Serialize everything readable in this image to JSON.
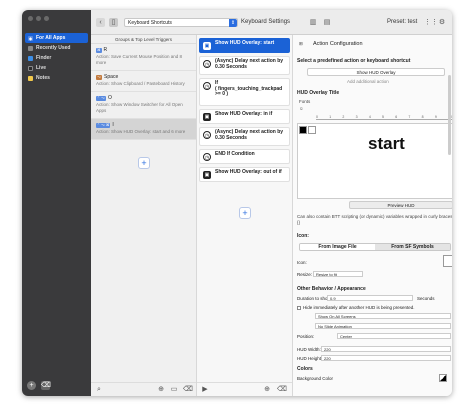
{
  "sidebar": {
    "apps": [
      {
        "label": "For All Apps",
        "selected": true
      },
      {
        "label": "Recently Used"
      },
      {
        "label": "Finder"
      },
      {
        "label": "Live"
      },
      {
        "label": "Notes"
      }
    ]
  },
  "toolbar": {
    "combo": "Keyboard Shortcuts",
    "settings": "Keyboard Settings",
    "preset": "Preset: test"
  },
  "triggers": {
    "header": "Groups & Top Level Triggers",
    "items": [
      {
        "title": "R",
        "key": "⌘",
        "desc": "Action: Save Current Mouse Position and 8 more"
      },
      {
        "title": "Space",
        "key": "⌥",
        "desc": "Action: Show Clipboard / Pasteboard History"
      },
      {
        "title": "O",
        "key": "⌃ ⌥",
        "desc": "Action: Show Window Switcher for All Open Apps"
      },
      {
        "title": "I",
        "key": "⌃ ⌥ ⌘",
        "desc": "Action: Show HUD Overlay: start and 6 more",
        "selected": true
      }
    ]
  },
  "actions": [
    {
      "label": "Show HUD Overlay: start",
      "selected": true
    },
    {
      "label": "(Async) Delay next action by 0.30 Seconds"
    },
    {
      "label": "If\n( fingers_touching_trackpad >= 0 )"
    },
    {
      "label": "Show HUD Overlay: in if"
    },
    {
      "label": "(Async) Delay next action by 0.30 Seconds"
    },
    {
      "label": "END If Condition"
    },
    {
      "label": "Show HUD Overlay: out of if"
    }
  ],
  "config": {
    "title": "Action Configuration",
    "predefined_label": "Select a predefined action or keyboard shortcut",
    "predefined_value": "Show HUD Overlay",
    "add_description": "Add additional action",
    "hud_title": "HUD Overlay Title",
    "fonts": "Fonts",
    "ruler": [
      "0",
      "1",
      "2",
      "3",
      "4",
      "5",
      "6",
      "7",
      "8",
      "9",
      "10"
    ],
    "preview_text": "start",
    "preview_button": "Preview HUD",
    "note": "Can also contain BTT scripting (or dynamic) variables wrapped in curly braces {}",
    "icon_header": "Icon:",
    "tab_image": "From Image File",
    "tab_symbols": "From SF Symbols",
    "icon_label": "Icon:",
    "resize_label": "Resize:",
    "resize_value": "Resize to fit",
    "behavior_header": "Other Behavior / Appearance",
    "duration_label": "Duration to show:",
    "duration_value": "0.9",
    "seconds": "Seconds",
    "hide_immediately": "Hide immediately after another HUD is being presented.",
    "show_on_all": "Show On All Screens",
    "slide_anim": "No Slide Animation",
    "position_label": "Position:",
    "position_value": "Center",
    "hud_width_label": "HUD Width:",
    "hud_width": "220",
    "hud_height_label": "HUD Height:",
    "hud_height": "220",
    "colors_header": "Colors",
    "bg_color": "Background Color"
  }
}
